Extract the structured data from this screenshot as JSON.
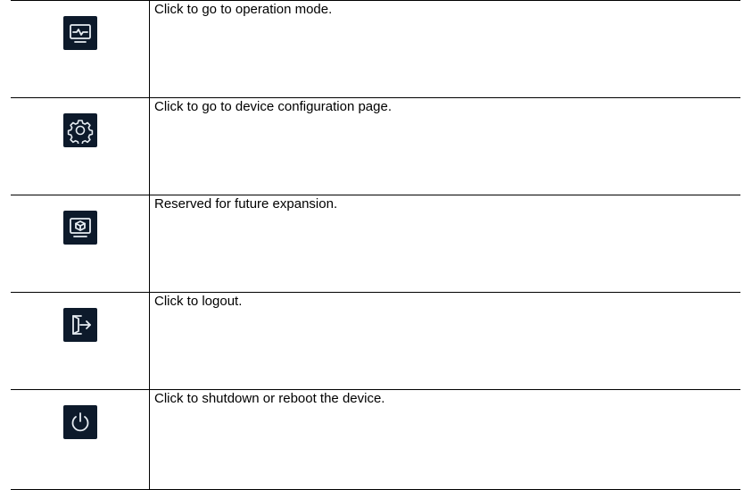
{
  "rows": [
    {
      "icon": "operation-mode-icon",
      "description": "Click to go to operation mode."
    },
    {
      "icon": "settings-gear-icon",
      "description": "Click to go to device configuration page."
    },
    {
      "icon": "expansion-monitor-icon",
      "description": "Reserved for future expansion."
    },
    {
      "icon": "logout-icon",
      "description": "Click to logout."
    },
    {
      "icon": "power-icon",
      "description": "Click to shutdown or reboot the device."
    }
  ],
  "colors": {
    "icon_background": "#0d1a2b",
    "icon_stroke": "#e6ecf2",
    "text": "#000000",
    "rule": "#000000"
  }
}
